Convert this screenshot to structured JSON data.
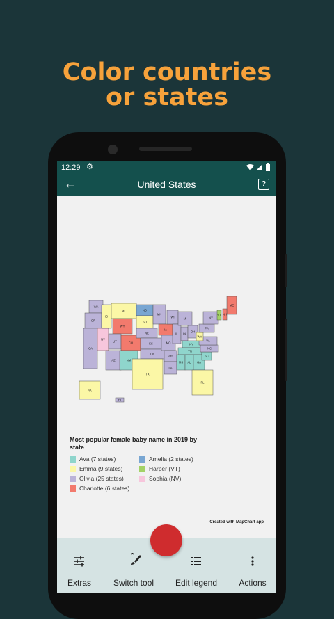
{
  "promo": {
    "line1": "Color countries",
    "line2": "or states"
  },
  "status": {
    "time": "12:29"
  },
  "appbar": {
    "title": "United States",
    "help": "?"
  },
  "legend": {
    "title": "Most popular female baby name in 2019 by state",
    "items": [
      {
        "label": "Ava (7 states)",
        "color": "#8fd5cc"
      },
      {
        "label": "Amelia (2 states)",
        "color": "#79a6d2"
      },
      {
        "label": "Emma (9 states)",
        "color": "#fbf7a6"
      },
      {
        "label": "Harper (VT)",
        "color": "#a3d266"
      },
      {
        "label": "Olivia (25 states)",
        "color": "#bbb3d8"
      },
      {
        "label": "Sophia (NV)",
        "color": "#f7c6dc"
      },
      {
        "label": "Charlotte (6 states)",
        "color": "#f27a6d"
      }
    ]
  },
  "credit": "Created with MapChart app",
  "bottom_nav": [
    {
      "label": "Extras",
      "icon": "sliders-icon"
    },
    {
      "label": "Switch tool",
      "icon": "brush-icon"
    },
    {
      "label": "Edit legend",
      "icon": "list-icon"
    },
    {
      "label": "Actions",
      "icon": "more-vert-icon"
    }
  ],
  "map_states": [
    {
      "abbr": "WA",
      "color": "#bbb3d8"
    },
    {
      "abbr": "OR",
      "color": "#bbb3d8"
    },
    {
      "abbr": "CA",
      "color": "#bbb3d8"
    },
    {
      "abbr": "NV",
      "color": "#f7c6dc"
    },
    {
      "abbr": "ID",
      "color": "#fbf7a6"
    },
    {
      "abbr": "MT",
      "color": "#fbf7a6"
    },
    {
      "abbr": "WY",
      "color": "#f27a6d"
    },
    {
      "abbr": "UT",
      "color": "#bbb3d8"
    },
    {
      "abbr": "AZ",
      "color": "#bbb3d8"
    },
    {
      "abbr": "CO",
      "color": "#f27a6d"
    },
    {
      "abbr": "NM",
      "color": "#8fd5cc"
    },
    {
      "abbr": "ND",
      "color": "#79a6d2"
    },
    {
      "abbr": "SD",
      "color": "#fbf7a6"
    },
    {
      "abbr": "NE",
      "color": "#bbb3d8"
    },
    {
      "abbr": "KS",
      "color": "#bbb3d8"
    },
    {
      "abbr": "OK",
      "color": "#bbb3d8"
    },
    {
      "abbr": "TX",
      "color": "#fbf7a6"
    },
    {
      "abbr": "MN",
      "color": "#bbb3d8"
    },
    {
      "abbr": "IA",
      "color": "#f27a6d"
    },
    {
      "abbr": "MO",
      "color": "#bbb3d8"
    },
    {
      "abbr": "AR",
      "color": "#bbb3d8"
    },
    {
      "abbr": "LA",
      "color": "#bbb3d8"
    },
    {
      "abbr": "WI",
      "color": "#bbb3d8"
    },
    {
      "abbr": "IL",
      "color": "#bbb3d8"
    },
    {
      "abbr": "MI",
      "color": "#bbb3d8"
    },
    {
      "abbr": "IN",
      "color": "#bbb3d8"
    },
    {
      "abbr": "OH",
      "color": "#bbb3d8"
    },
    {
      "abbr": "KY",
      "color": "#8fd5cc"
    },
    {
      "abbr": "TN",
      "color": "#8fd5cc"
    },
    {
      "abbr": "MS",
      "color": "#8fd5cc"
    },
    {
      "abbr": "AL",
      "color": "#8fd5cc"
    },
    {
      "abbr": "GA",
      "color": "#8fd5cc"
    },
    {
      "abbr": "FL",
      "color": "#fbf7a6"
    },
    {
      "abbr": "SC",
      "color": "#8fd5cc"
    },
    {
      "abbr": "NC",
      "color": "#bbb3d8"
    },
    {
      "abbr": "VA",
      "color": "#bbb3d8"
    },
    {
      "abbr": "WV",
      "color": "#fbf7a6"
    },
    {
      "abbr": "PA",
      "color": "#bbb3d8"
    },
    {
      "abbr": "NY",
      "color": "#bbb3d8"
    },
    {
      "abbr": "ME",
      "color": "#f27a6d"
    },
    {
      "abbr": "NH",
      "color": "#f27a6d"
    },
    {
      "abbr": "VT",
      "color": "#a3d266"
    },
    {
      "abbr": "AK",
      "color": "#fbf7a6"
    },
    {
      "abbr": "HI",
      "color": "#bbb3d8"
    }
  ]
}
